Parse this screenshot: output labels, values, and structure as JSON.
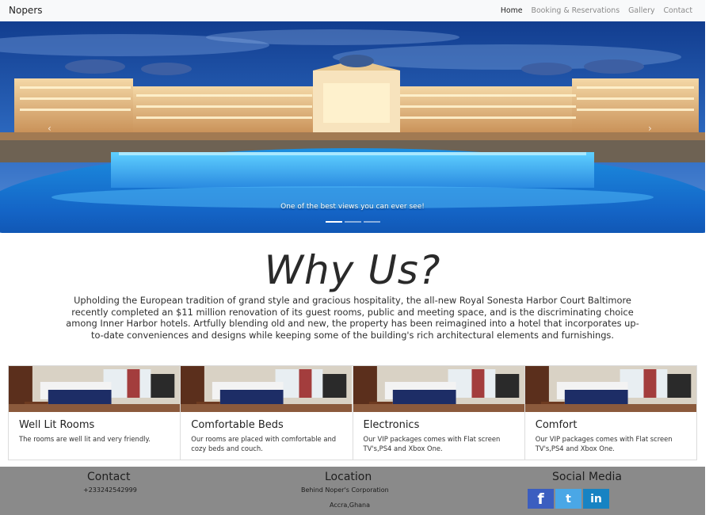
{
  "navbar": {
    "brand": "Nopers",
    "links": [
      "Home",
      "Booking & Reservations",
      "Gallery",
      "Contact"
    ]
  },
  "hero": {
    "caption": "One of the best views you can ever see!",
    "prev_arrow": "‹",
    "next_arrow": "›",
    "slides_total": 3,
    "active_slide": 1
  },
  "why": {
    "title": "Why Us?",
    "text": "Upholding the European tradition of grand style and gracious hospitality, the all-new Royal Sonesta Harbor Court Baltimore recently completed an $11 million renovation of its guest rooms, public and meeting space, and is the discriminating choice among Inner Harbor hotels. Artfully blending old and new, the property has been reimagined into a hotel that incorporates up-to-date conveniences and designs while keeping some of the building's rich architectural elements and furnishings."
  },
  "cards": [
    {
      "title": "Well Lit Rooms",
      "text": "The rooms are well lit and very friendly."
    },
    {
      "title": "Comfortable Beds",
      "text": "Our rooms are placed with comfortable and cozy beds and couch."
    },
    {
      "title": "Electronics",
      "text": "Our VIP packages comes with Flat screen TV's,PS4 and Xbox One."
    },
    {
      "title": "Comfort",
      "text": "Our VIP packages comes with Flat screen TV's,PS4 and Xbox One."
    }
  ],
  "footer": {
    "contact": {
      "heading": "Contact",
      "phone": "+233242542999"
    },
    "location": {
      "heading": "Location",
      "line1": "Behind Noper's Corporation",
      "line2": "Accra,Ghana"
    },
    "social": {
      "heading": "Social Media",
      "icons": [
        "facebook-icon",
        "twitter-icon",
        "linkedin-icon"
      ],
      "facebook_glyph": "f",
      "twitter_glyph": "t",
      "linkedin_glyph": "in"
    }
  }
}
